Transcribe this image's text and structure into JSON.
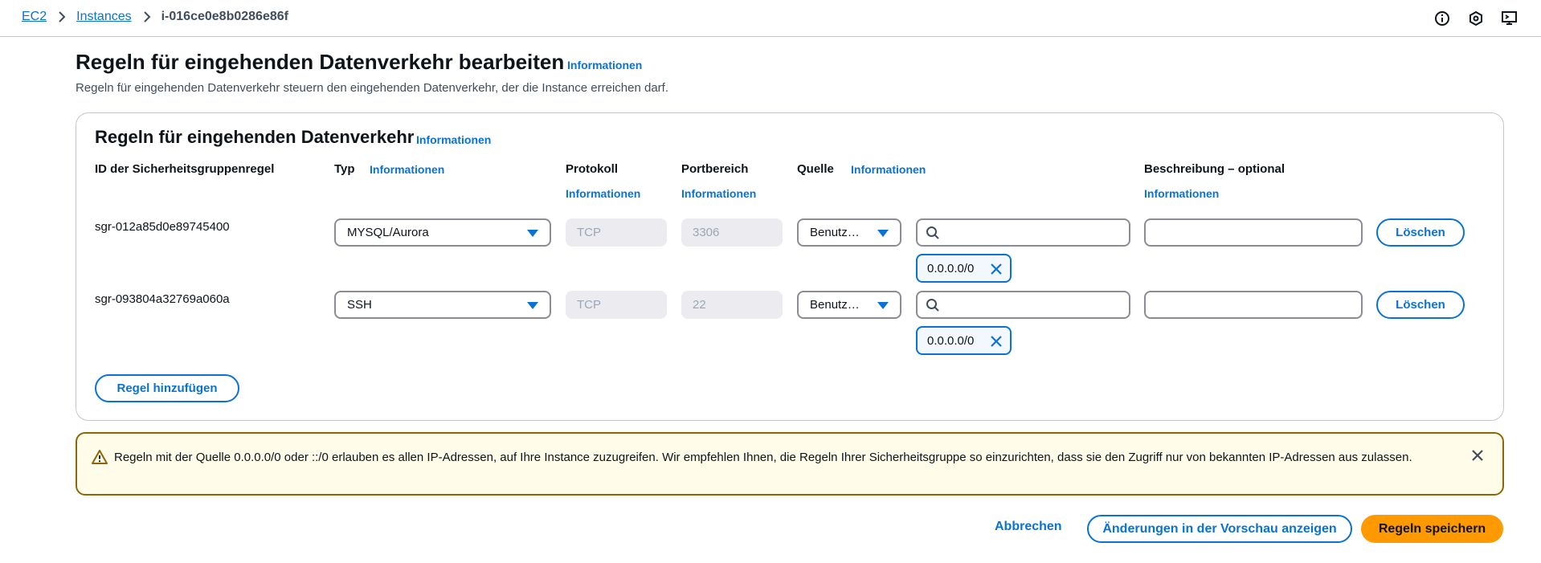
{
  "breadcrumb": {
    "items": [
      "EC2",
      "Instances"
    ],
    "current": "i-016ce0e8b0286e86f"
  },
  "header": {
    "title": "Regeln für eingehenden Datenverkehr bearbeiten",
    "info": "Informationen",
    "description": "Regeln für eingehenden Datenverkehr steuern den eingehenden Datenverkehr, der die Instance erreichen darf."
  },
  "container": {
    "title": "Regeln für eingehenden Datenverkehr",
    "info": "Informationen",
    "columns": {
      "rule_id": "ID der Sicherheitsgruppenregel",
      "type": "Typ",
      "protocol": "Protokoll",
      "port_range": "Portbereich",
      "source": "Quelle",
      "description": "Beschreibung – optional",
      "info": "Informationen"
    },
    "rules": [
      {
        "id": "sgr-012a85d0e89745400",
        "type": "MYSQL/Aurora",
        "protocol": "TCP",
        "port": "3306",
        "source": "Benutz…",
        "token": "0.0.0.0/0",
        "delete": "Löschen"
      },
      {
        "id": "sgr-093804a32769a060a",
        "type": "SSH",
        "protocol": "TCP",
        "port": "22",
        "source": "Benutz…",
        "token": "0.0.0.0/0",
        "delete": "Löschen"
      }
    ],
    "add_rule": "Regel hinzufügen"
  },
  "warning": {
    "text": "Regeln mit der Quelle 0.0.0.0/0 oder ::/0 erlauben es allen IP-Adressen, auf Ihre Instance zuzugreifen. Wir empfehlen Ihnen, die Regeln Ihrer Sicherheitsgruppe so einzurichten, dass sie den Zugriff nur von bekannten IP-Adressen aus zulassen."
  },
  "footer": {
    "cancel": "Abbrechen",
    "preview": "Änderungen in der Vorschau anzeigen",
    "save": "Regeln speichern"
  },
  "colors": {
    "link": "#0972d3",
    "primary": "#ff9900",
    "warning_border": "#8d6605",
    "warning_bg": "#fffce9"
  }
}
